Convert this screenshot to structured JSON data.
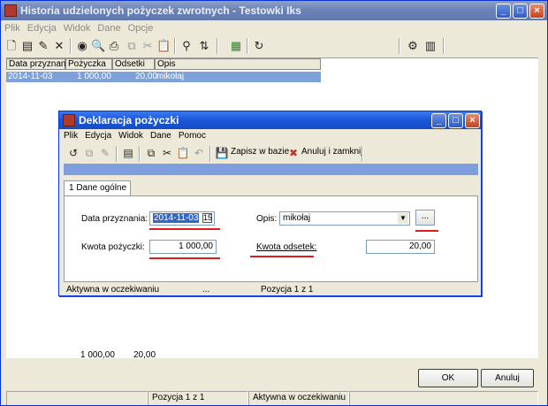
{
  "main": {
    "title": "Historia udzielonych pożyczek zwrotnych - Testowki Iks",
    "menu": [
      "Plik",
      "Edycja",
      "Widok",
      "Dane",
      "Opcje"
    ],
    "columns": [
      "Data przyznania",
      "Pożyczka",
      "Odsetki",
      "Opis"
    ],
    "rows": [
      {
        "date": "2014-11-03",
        "loan": "1 000,00",
        "interest": "20,00",
        "desc": "mikołaj"
      }
    ],
    "totals": {
      "loan": "1 000,00",
      "interest": "20,00"
    },
    "ok_label": "OK",
    "cancel_label": "Anuluj",
    "status": [
      "Pozycja 1 z 1",
      "Aktywna w oczekiwaniu"
    ]
  },
  "dialog": {
    "title": "Deklaracja pożyczki",
    "menu": [
      "Plik",
      "Edycja",
      "Widok",
      "Dane",
      "Pomoc"
    ],
    "save_label": "Zapisz w bazie",
    "cancel_close_label": "Anuluj i zamknij",
    "tab_label": "1 Dane ogólne",
    "fields": {
      "date_label": "Data przyznania:",
      "date_value": "2014-11-03",
      "loan_label": "Kwota pożyczki:",
      "loan_value": "1 000,00",
      "desc_label": "Opis:",
      "desc_value": "mikołaj",
      "interest_label": "Kwota odsetek:",
      "interest_value": "20,00",
      "browse_label": "..."
    },
    "status": [
      "Aktywna w oczekiwaniu",
      "...",
      "Pozycja 1 z 1"
    ]
  },
  "colors": {
    "accent": "#316ac5",
    "selection": "#7da1d8",
    "annotation": "#d81e1e"
  }
}
